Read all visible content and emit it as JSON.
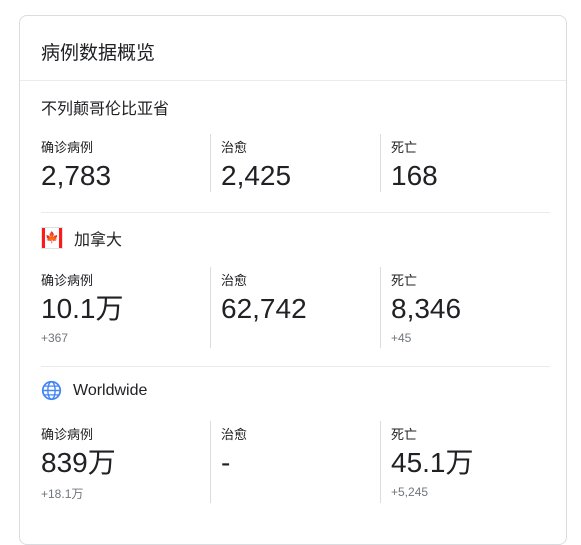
{
  "card": {
    "title": "病例数据概览"
  },
  "sections": [
    {
      "region": "不列颠哥伦比亚省",
      "stats": [
        {
          "label": "确诊病例",
          "value": "2,783",
          "delta": ""
        },
        {
          "label": "治愈",
          "value": "2,425",
          "delta": ""
        },
        {
          "label": "死亡",
          "value": "168",
          "delta": ""
        }
      ]
    },
    {
      "region": "加拿大",
      "flag_leaf": "🍁",
      "stats": [
        {
          "label": "确诊病例",
          "value": "10.1万",
          "delta": "+367"
        },
        {
          "label": "治愈",
          "value": "62,742",
          "delta": ""
        },
        {
          "label": "死亡",
          "value": "8,346",
          "delta": "+45"
        }
      ]
    },
    {
      "region": "Worldwide",
      "icon": "globe-icon",
      "stats": [
        {
          "label": "确诊病例",
          "value": "839万",
          "delta": "+18.1万"
        },
        {
          "label": "治愈",
          "value": "-",
          "delta": ""
        },
        {
          "label": "死亡",
          "value": "45.1万",
          "delta": "+5,245"
        }
      ]
    }
  ],
  "colors": {
    "flag_red": "#ff1a1a",
    "globe_blue": "#4285f4",
    "muted": "#70757a"
  }
}
